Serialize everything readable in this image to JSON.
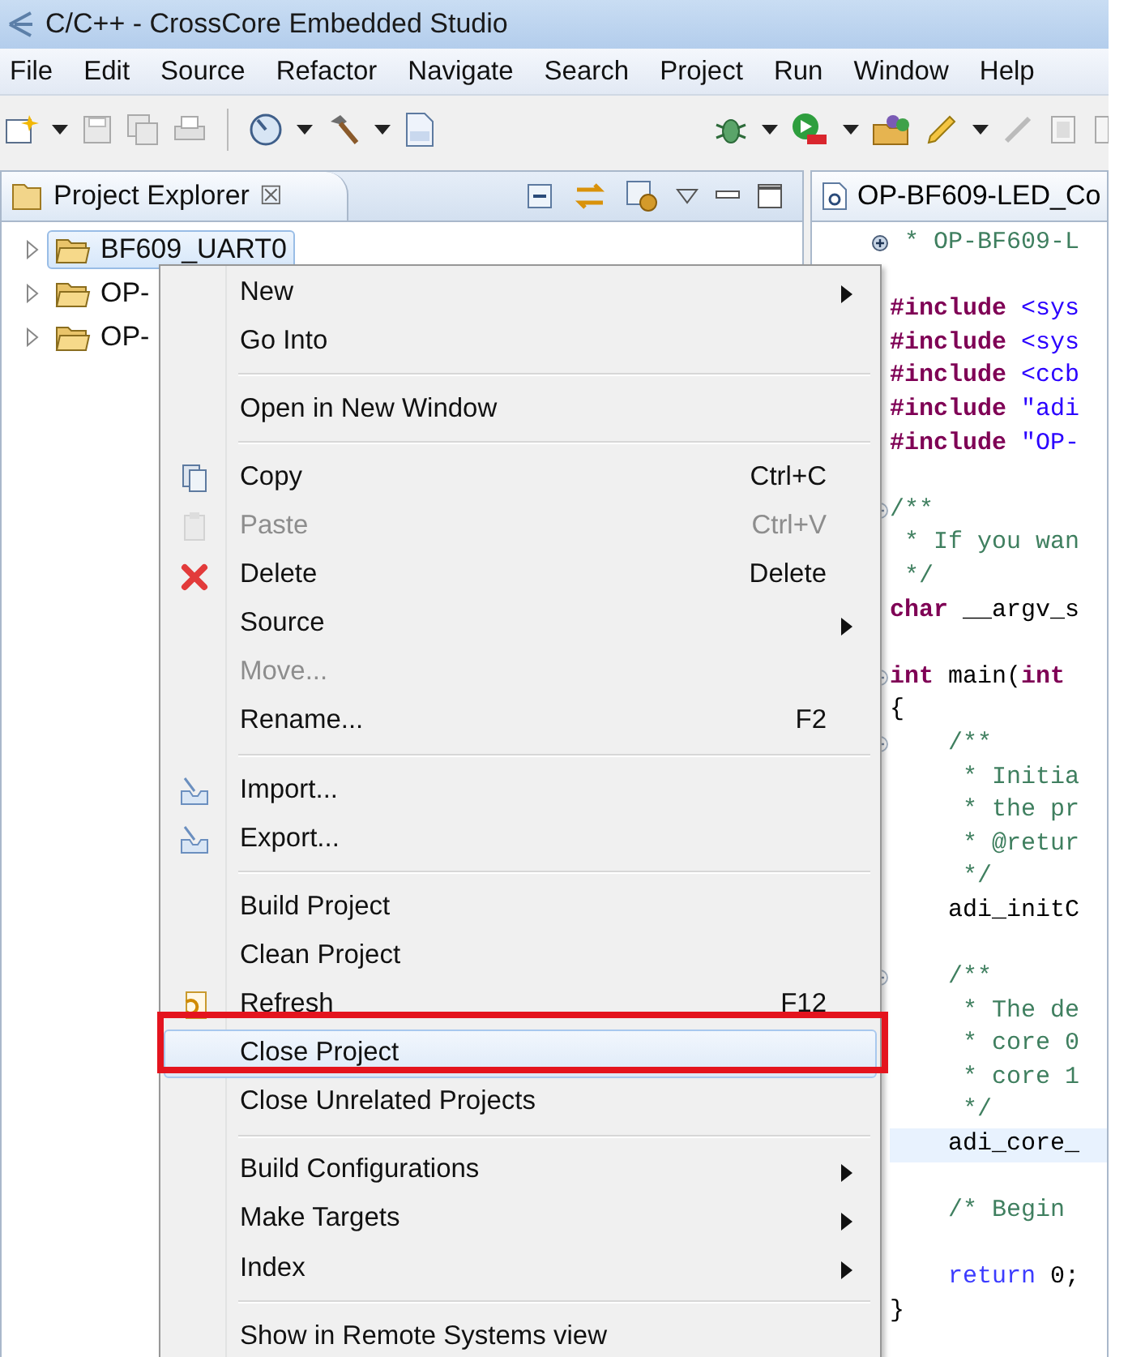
{
  "window": {
    "title": "C/C++ - CrossCore Embedded Studio"
  },
  "menu_bar": [
    "File",
    "Edit",
    "Source",
    "Refactor",
    "Navigate",
    "Search",
    "Project",
    "Run",
    "Window",
    "Help"
  ],
  "project_explorer": {
    "title": "Project Explorer",
    "close": "☒",
    "tree": [
      {
        "label": "BF609_UART0",
        "selected": true,
        "expanded": false
      },
      {
        "label": "OP-",
        "selected": false,
        "expanded": false
      },
      {
        "label": "OP-",
        "selected": false,
        "expanded": false
      }
    ]
  },
  "editor": {
    "tab_title": "OP-BF609-LED_Co",
    "lines": [
      {
        "fold": {
          "collapsed": true
        },
        "current": false,
        "tokens": [
          {
            "kind": "comment",
            "text": " * OP-BF609-L"
          }
        ]
      },
      {
        "current": false
      },
      {
        "current": false,
        "tokens": [
          {
            "kind": "directive",
            "text": "#include"
          },
          {
            "kind": "string",
            "text": " <sys"
          }
        ]
      },
      {
        "current": false,
        "tokens": [
          {
            "kind": "directive",
            "text": "#include"
          },
          {
            "kind": "string",
            "text": " <sys"
          }
        ]
      },
      {
        "current": false,
        "tokens": [
          {
            "kind": "directive",
            "text": "#include"
          },
          {
            "kind": "string",
            "text": " <ccb"
          }
        ]
      },
      {
        "current": false,
        "tokens": [
          {
            "kind": "directive",
            "text": "#include"
          },
          {
            "kind": "string",
            "text": " \"adi"
          }
        ]
      },
      {
        "current": false,
        "tokens": [
          {
            "kind": "directive",
            "text": "#include"
          },
          {
            "kind": "string",
            "text": " \"OP-"
          }
        ]
      },
      {
        "current": false
      },
      {
        "fold": {
          "collapsed": false
        },
        "current": false,
        "tokens": [
          {
            "kind": "comment",
            "text": "/**"
          }
        ]
      },
      {
        "current": false,
        "tokens": [
          {
            "kind": "comment",
            "text": " * If you wan"
          }
        ]
      },
      {
        "current": false,
        "tokens": [
          {
            "kind": "comment",
            "text": " */"
          }
        ]
      },
      {
        "current": false,
        "tokens": [
          {
            "kind": "keyword",
            "text": "char"
          },
          {
            "kind": "plain",
            "text": " __argv_s"
          }
        ]
      },
      {
        "current": false
      },
      {
        "fold": {
          "collapsed": false
        },
        "current": false,
        "tokens": [
          {
            "kind": "keyword",
            "text": "int"
          },
          {
            "kind": "plain",
            "text": " main("
          },
          {
            "kind": "keyword",
            "text": "int"
          }
        ]
      },
      {
        "current": false,
        "tokens": [
          {
            "kind": "plain",
            "text": "{"
          }
        ]
      },
      {
        "fold": {
          "collapsed": false
        },
        "current": false,
        "tokens": [
          {
            "kind": "comment",
            "text": "    /**"
          }
        ]
      },
      {
        "current": false,
        "tokens": [
          {
            "kind": "comment",
            "text": "     * Initia"
          }
        ]
      },
      {
        "current": false,
        "tokens": [
          {
            "kind": "comment",
            "text": "     * the pr"
          }
        ]
      },
      {
        "current": false,
        "tokens": [
          {
            "kind": "comment",
            "text": "     * @retur"
          }
        ]
      },
      {
        "current": false,
        "tokens": [
          {
            "kind": "comment",
            "text": "     */"
          }
        ]
      },
      {
        "current": false,
        "tokens": [
          {
            "kind": "plain",
            "text": "    adi_initC"
          }
        ]
      },
      {
        "current": false
      },
      {
        "fold": {
          "collapsed": false
        },
        "current": false,
        "tokens": [
          {
            "kind": "comment",
            "text": "    /**"
          }
        ]
      },
      {
        "current": false,
        "tokens": [
          {
            "kind": "comment",
            "text": "     * The de"
          }
        ]
      },
      {
        "current": false,
        "tokens": [
          {
            "kind": "comment",
            "text": "     * core 0"
          }
        ]
      },
      {
        "current": false,
        "tokens": [
          {
            "kind": "comment",
            "text": "     * core 1"
          }
        ]
      },
      {
        "current": false,
        "tokens": [
          {
            "kind": "comment",
            "text": "     */"
          }
        ]
      },
      {
        "current": true,
        "tokens": [
          {
            "kind": "plain",
            "text": "    adi_core_"
          }
        ]
      },
      {
        "current": false
      },
      {
        "current": false,
        "tokens": [
          {
            "kind": "comment",
            "text": "    /* Begin"
          }
        ]
      },
      {
        "current": false
      },
      {
        "current": false,
        "tokens": [
          {
            "kind": "return",
            "text": "    return"
          },
          {
            "kind": "plain",
            "text": " 0;"
          }
        ]
      },
      {
        "current": false,
        "tokens": [
          {
            "kind": "plain",
            "text": "}"
          }
        ]
      }
    ]
  },
  "context_menu": [
    {
      "kind": "item",
      "label": "New",
      "submenu": true,
      "disabled": false,
      "selected": false
    },
    {
      "kind": "item",
      "label": "Go Into",
      "submenu": false,
      "disabled": false,
      "selected": false
    },
    {
      "kind": "separator"
    },
    {
      "kind": "item",
      "label": "Open in New Window",
      "submenu": false,
      "disabled": false,
      "selected": false
    },
    {
      "kind": "separator"
    },
    {
      "kind": "item",
      "label": "Copy",
      "shortcut": "Ctrl+C",
      "submenu": false,
      "disabled": false,
      "selected": false
    },
    {
      "kind": "item",
      "label": "Paste",
      "shortcut": "Ctrl+V",
      "submenu": false,
      "disabled": true,
      "selected": false
    },
    {
      "kind": "item",
      "label": "Delete",
      "shortcut": "Delete",
      "submenu": false,
      "disabled": false,
      "selected": false
    },
    {
      "kind": "item",
      "label": "Source",
      "submenu": true,
      "disabled": false,
      "selected": false
    },
    {
      "kind": "item",
      "label": "Move...",
      "submenu": false,
      "disabled": true,
      "selected": false
    },
    {
      "kind": "item",
      "label": "Rename...",
      "shortcut": "F2",
      "submenu": false,
      "disabled": false,
      "selected": false
    },
    {
      "kind": "separator"
    },
    {
      "kind": "item",
      "label": "Import...",
      "submenu": false,
      "disabled": false,
      "selected": false
    },
    {
      "kind": "item",
      "label": "Export...",
      "submenu": false,
      "disabled": false,
      "selected": false
    },
    {
      "kind": "separator"
    },
    {
      "kind": "item",
      "label": "Build Project",
      "submenu": false,
      "disabled": false,
      "selected": false
    },
    {
      "kind": "item",
      "label": "Clean Project",
      "submenu": false,
      "disabled": false,
      "selected": false
    },
    {
      "kind": "item",
      "label": "Refresh",
      "shortcut": "F12",
      "submenu": false,
      "disabled": false,
      "selected": false
    },
    {
      "kind": "item",
      "label": "Close Project",
      "submenu": false,
      "disabled": false,
      "selected": true
    },
    {
      "kind": "item",
      "label": "Close Unrelated Projects",
      "submenu": false,
      "disabled": false,
      "selected": false
    },
    {
      "kind": "separator"
    },
    {
      "kind": "item",
      "label": "Build Configurations",
      "submenu": true,
      "disabled": false,
      "selected": false
    },
    {
      "kind": "item",
      "label": "Make Targets",
      "submenu": true,
      "disabled": false,
      "selected": false
    },
    {
      "kind": "item",
      "label": "Index",
      "submenu": true,
      "disabled": false,
      "selected": false
    },
    {
      "kind": "separator"
    },
    {
      "kind": "item",
      "label": "Show in Remote Systems view",
      "submenu": false,
      "disabled": false,
      "selected": false
    }
  ]
}
